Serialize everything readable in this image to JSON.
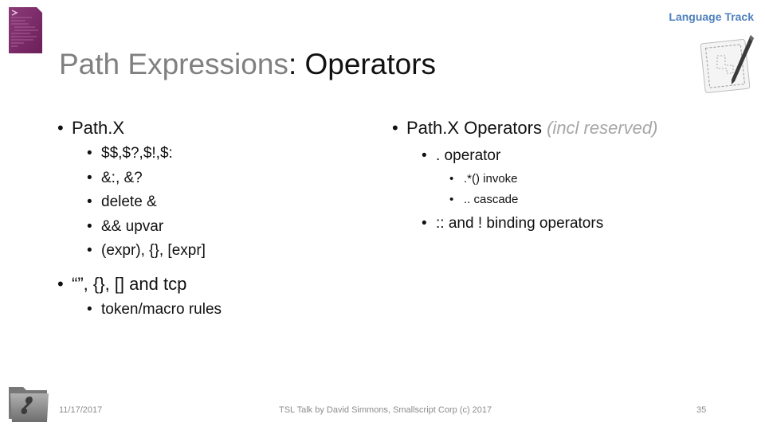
{
  "header": {
    "track_label": "Language Track",
    "track_color": "#4f81bd",
    "icons": [
      "document-icon",
      "drafting-pen-icon"
    ]
  },
  "title": {
    "part1": "Path Expressions",
    "separator": ":",
    "part2": " Operators",
    "part1_color": "#808080"
  },
  "left_column": {
    "heading": "Path.X",
    "items": [
      "$$,$?,$!,$:",
      "&:, &?",
      "delete &",
      "&& upvar",
      "(expr), {}, [expr]"
    ]
  },
  "left_column_2": {
    "heading": "“”, {}, [] and tcp",
    "items": [
      "token/macro rules"
    ]
  },
  "right_column": {
    "heading": "Path.X Operators",
    "heading_note": "(incl reserved)",
    "items": [
      {
        "label": ". operator",
        "subitems": [
          ".*() invoke",
          ".. cascade"
        ]
      },
      {
        "label": ":: and ! binding operators",
        "subitems": []
      }
    ]
  },
  "footer": {
    "date": "11/17/2017",
    "credit": "TSL Talk by David Simmons, Smallscript Corp (c) 2017",
    "page_number": "35",
    "icon": "folder-icon"
  },
  "bullet": "•"
}
